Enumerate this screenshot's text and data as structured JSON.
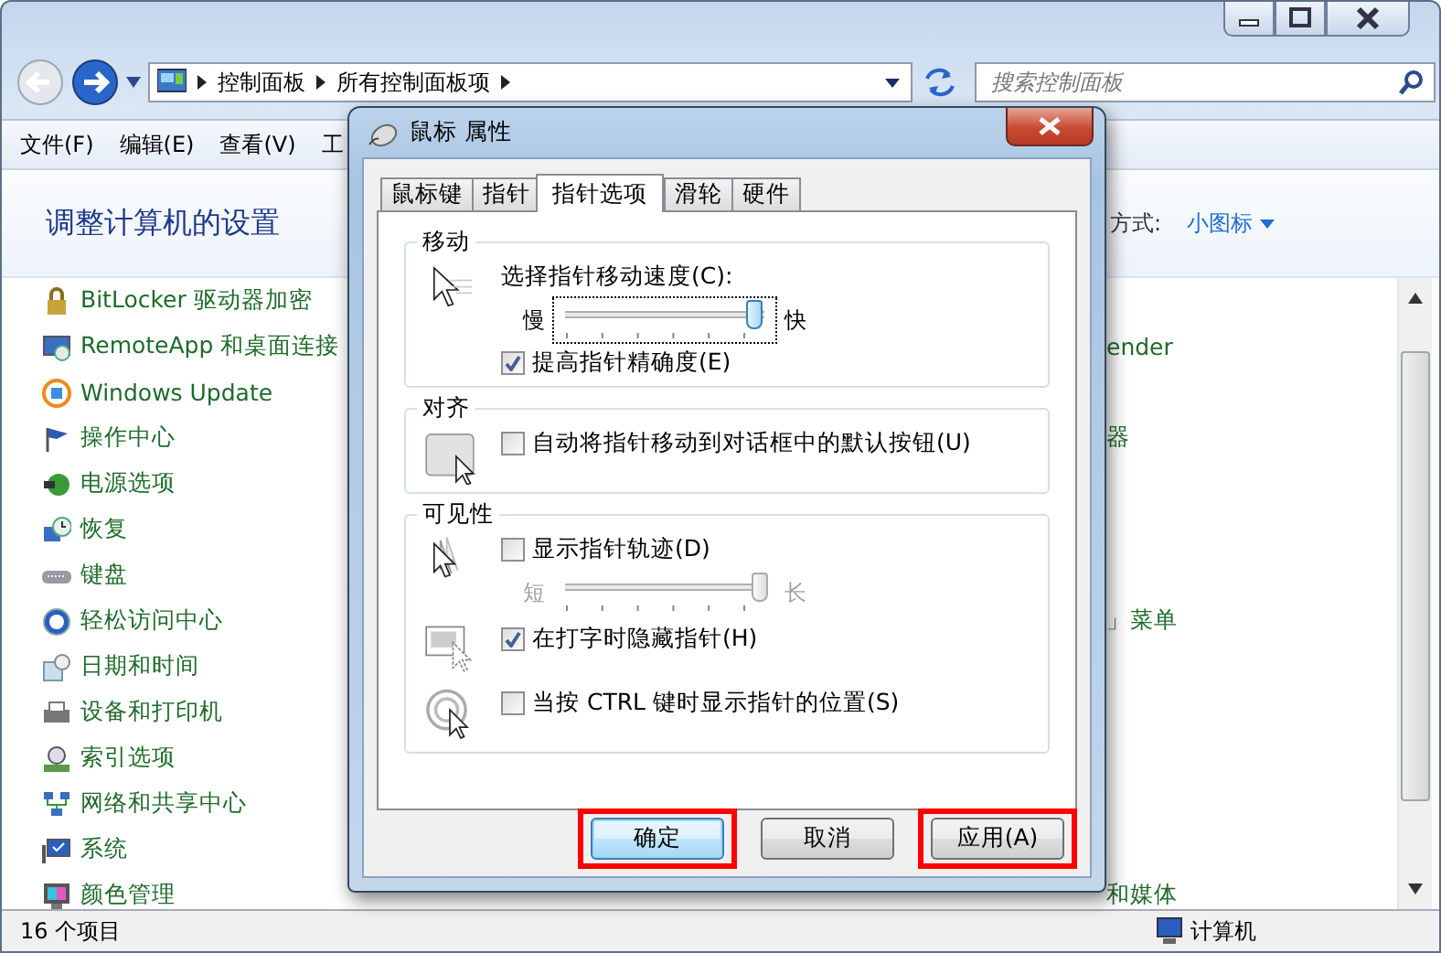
{
  "explorer": {
    "address": {
      "path": [
        "控制面板",
        "所有控制面板项"
      ],
      "search_placeholder": "搜索控制面板"
    },
    "menu": [
      "文件(F)",
      "编辑(E)",
      "查看(V)",
      "工"
    ],
    "heading": "调整计算机的设置",
    "view_by": {
      "label": "方式:",
      "value": "小图标"
    },
    "items": [
      {
        "label": "BitLocker 驱动器加密"
      },
      {
        "label": "RemoteApp 和桌面连接",
        "right_label": "ender"
      },
      {
        "label": "Windows Update"
      },
      {
        "label": "操作中心",
        "right_label": "器"
      },
      {
        "label": "电源选项"
      },
      {
        "label": "恢复"
      },
      {
        "label": "键盘"
      },
      {
        "label": "轻松访问中心",
        "right_label": "」菜单"
      },
      {
        "label": "日期和时间"
      },
      {
        "label": "设备和打印机"
      },
      {
        "label": "索引选项"
      },
      {
        "label": "网络和共享中心"
      },
      {
        "label": "系统"
      },
      {
        "label": "颜色管理",
        "right_label": "和媒体"
      }
    ],
    "status": {
      "count": "16 个项目",
      "location": "计算机"
    }
  },
  "dialog": {
    "title": "鼠标 属性",
    "tabs": [
      {
        "label": "鼠标键",
        "selected": false
      },
      {
        "label": "指针",
        "selected": false
      },
      {
        "label": "指针选项",
        "selected": true
      },
      {
        "label": "滑轮",
        "selected": false
      },
      {
        "label": "硬件",
        "selected": false
      }
    ],
    "groups": [
      {
        "title": "移动",
        "blocks": [
          {
            "rows": [
              {
                "kind": "label",
                "text": "选择指针移动速度(C):"
              },
              {
                "kind": "slider",
                "min": "慢",
                "max": "快",
                "level": 0.95,
                "focused": true,
                "disabled": false
              },
              {
                "kind": "checkbox",
                "label": "提高指针精确度(E)",
                "checked": true
              }
            ]
          }
        ]
      },
      {
        "title": "对齐",
        "blocks": [
          {
            "rows": [
              {
                "kind": "checkbox",
                "label": "自动将指针移动到对话框中的默认按钮(U)",
                "checked": false
              }
            ]
          }
        ]
      },
      {
        "title": "可见性",
        "blocks": [
          {
            "rows": [
              {
                "kind": "checkbox",
                "label": "显示指针轨迹(D)",
                "checked": false
              },
              {
                "kind": "slider",
                "min": "短",
                "max": "长",
                "level": 0.98,
                "focused": false,
                "disabled": true
              }
            ]
          },
          {
            "rows": [
              {
                "kind": "checkbox",
                "label": "在打字时隐藏指针(H)",
                "checked": true
              }
            ]
          },
          {
            "rows": [
              {
                "kind": "checkbox",
                "label": "当按 CTRL 键时显示指针的位置(S)",
                "checked": false
              }
            ]
          }
        ]
      }
    ],
    "buttons": [
      {
        "label": "确定",
        "default": true,
        "highlighted": true
      },
      {
        "label": "取消",
        "default": false,
        "highlighted": false
      },
      {
        "label": "应用(A)",
        "default": false,
        "highlighted": true
      }
    ]
  }
}
